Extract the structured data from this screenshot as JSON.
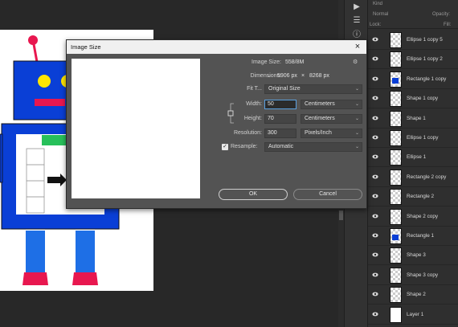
{
  "layers_panel": {
    "search_placeholder": "Kind",
    "blend_mode": "Normal",
    "opacity_label": "Opacity:",
    "lock_label": "Lock:",
    "fill_label": "Fill:",
    "layers": [
      {
        "name": "Ellipse 1 copy 5",
        "thumb": "checker"
      },
      {
        "name": "Ellipse 1 copy 2",
        "thumb": "checker"
      },
      {
        "name": "Rectangle 1 copy",
        "thumb": "checker-blue"
      },
      {
        "name": "Shape 1 copy",
        "thumb": "checker"
      },
      {
        "name": "Shape 1",
        "thumb": "checker"
      },
      {
        "name": "Ellipse 1 copy",
        "thumb": "checker"
      },
      {
        "name": "Ellipse 1",
        "thumb": "checker"
      },
      {
        "name": "Rectangle 2 copy",
        "thumb": "checker"
      },
      {
        "name": "Rectangle 2",
        "thumb": "checker"
      },
      {
        "name": "Shape 2 copy",
        "thumb": "checker"
      },
      {
        "name": "Rectangle 1",
        "thumb": "checker-blue"
      },
      {
        "name": "Shape 3",
        "thumb": "checker"
      },
      {
        "name": "Shape 3 copy",
        "thumb": "checker"
      },
      {
        "name": "Shape 2",
        "thumb": "checker"
      },
      {
        "name": "Layer 1",
        "thumb": "white"
      }
    ]
  },
  "dialog": {
    "title": "Image Size",
    "image_size_label": "Image Size:",
    "image_size_value": "558/8M",
    "dimensions_label": "Dimensions:",
    "dim_width": "5906 px",
    "dim_sep": "×",
    "dim_height": "8268 px",
    "fit_to_label": "Fit T...",
    "fit_to_value": "Original Size",
    "width_label": "Width:",
    "width_value": "50",
    "width_unit": "Centimeters",
    "height_label": "Height:",
    "height_value": "70",
    "height_unit": "Centimeters",
    "resolution_label": "Resolution:",
    "resolution_value": "300",
    "resolution_unit": "Pixels/Inch",
    "resample_label": "Resample:",
    "resample_checked": true,
    "resample_value": "Automatic",
    "ok_label": "OK",
    "cancel_label": "Cancel"
  },
  "colors": {
    "robot_blue": "#0a3fd6",
    "robot_red": "#e8174f",
    "robot_yellow": "#ffe600",
    "robot_green": "#27c05a",
    "bg_dark": "#282828",
    "dialog_bg": "#535353"
  },
  "icons": {
    "close": "×",
    "chevron": "⌄",
    "gear": "⚙",
    "check": "✓"
  }
}
